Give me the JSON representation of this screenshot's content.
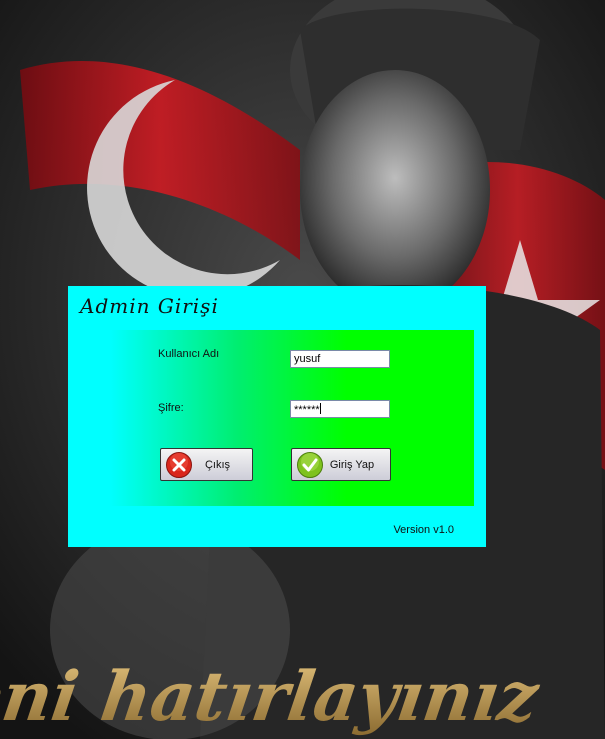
{
  "background": {
    "caption_text": "Beni hatırlayınız"
  },
  "login": {
    "title": "Admin Girişi",
    "username_label": "Kullanıcı Adı",
    "username_value": "yusuf",
    "password_label": "Şifre:",
    "password_masked": "******",
    "exit_button": "Çıkış",
    "exit_icon": "close-icon",
    "login_button": "Giriş Yap",
    "login_icon": "check-icon",
    "version": "Version v1.0"
  },
  "colors": {
    "window": "#00ffff",
    "panel_start": "#00ffff",
    "panel_end": "#00ff00",
    "flag_red": "#c8141e",
    "exit_icon_red": "#d9261c",
    "login_icon_green": "#7ec21e",
    "caption_gold": "#c9a15a"
  }
}
